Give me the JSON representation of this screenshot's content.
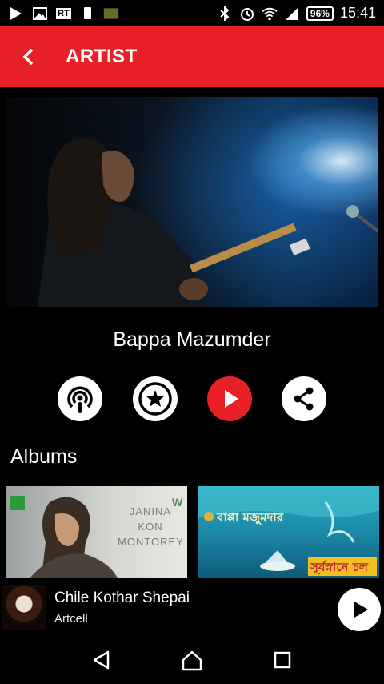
{
  "status_bar": {
    "battery": "96%",
    "time": "15:41",
    "left_icons": [
      "play-icon",
      "image-icon",
      "rt-news-icon",
      "sim-icon",
      "app-icon"
    ],
    "right_icons": [
      "bluetooth-icon",
      "alarm-icon",
      "wifi-icon",
      "signal-icon"
    ],
    "rt_label": "RT"
  },
  "app_bar": {
    "title": "ARTIST",
    "back_icon": "chevron-left-icon",
    "background": "#ea2027"
  },
  "artist": {
    "name": "Bappa Mazumder"
  },
  "actions": [
    {
      "icon": "podcast-icon"
    },
    {
      "icon": "star-icon"
    },
    {
      "icon": "play-icon",
      "color": "#ea2027"
    },
    {
      "icon": "share-icon"
    }
  ],
  "albums": {
    "heading": "Albums",
    "items": [
      {
        "cover_text": "JANINA KON MONTOREY"
      },
      {
        "cover_text": "বাপ্পা মজুমদার"
      }
    ]
  },
  "now_playing": {
    "title": "Chile Kothar Shepai",
    "artist": "Artcell"
  },
  "nav": {
    "icons": [
      "back-triangle-icon",
      "home-icon",
      "recents-icon"
    ]
  }
}
